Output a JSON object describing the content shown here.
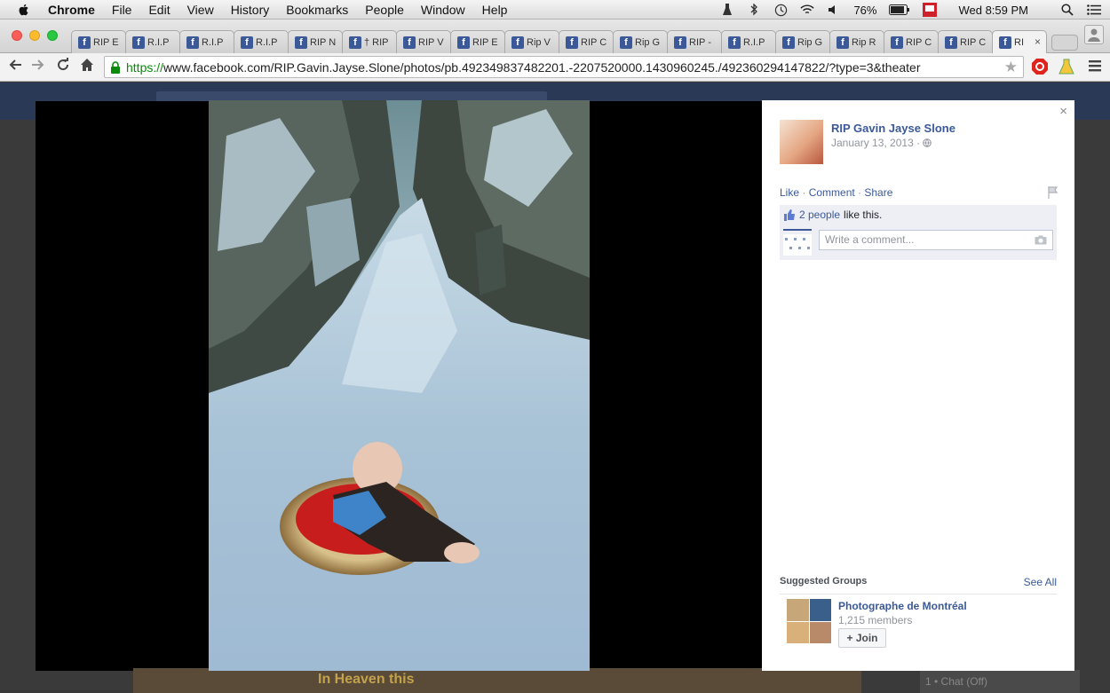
{
  "menubar": {
    "app": "Chrome",
    "items": [
      "File",
      "Edit",
      "View",
      "History",
      "Bookmarks",
      "People",
      "Window",
      "Help"
    ],
    "battery": "76%",
    "clock": "Wed 8:59 PM"
  },
  "tabs": [
    {
      "label": "RIP E"
    },
    {
      "label": "R.I.P"
    },
    {
      "label": "R.I.P"
    },
    {
      "label": "R.I.P"
    },
    {
      "label": "RIP N"
    },
    {
      "label": "† RIP"
    },
    {
      "label": "RIP V"
    },
    {
      "label": "RIP E"
    },
    {
      "label": "Rip V"
    },
    {
      "label": "RIP C"
    },
    {
      "label": "Rip G"
    },
    {
      "label": "RIP -"
    },
    {
      "label": "R.I.P"
    },
    {
      "label": "Rip G"
    },
    {
      "label": "Rip R"
    },
    {
      "label": "RIP C"
    },
    {
      "label": "RIP C"
    },
    {
      "label": "RI"
    }
  ],
  "toolbar": {
    "url_scheme": "https://",
    "url_rest": "www.facebook.com/RIP.Gavin.Jayse.Slone/photos/pb.492349837482201.-2207520000.1430960245./492360294147822/?type=3&theater"
  },
  "background": {
    "strip_text": "In Heaven this",
    "chat": "1 • Chat (Off)"
  },
  "panel": {
    "close": "×",
    "page_name": "RIP Gavin Jayse Slone",
    "date": "January 13, 2013 · ",
    "actions": {
      "like": "Like",
      "comment": "Comment",
      "share": "Share",
      "sep": " · "
    },
    "likes_link": "2 people",
    "likes_text": "like this.",
    "comment_placeholder": "Write a comment...",
    "suggested_title": "Suggested Groups",
    "see_all": "See All",
    "group_name": "Photographe de Montréal",
    "group_members": "1,215 members",
    "join": "+ Join"
  }
}
